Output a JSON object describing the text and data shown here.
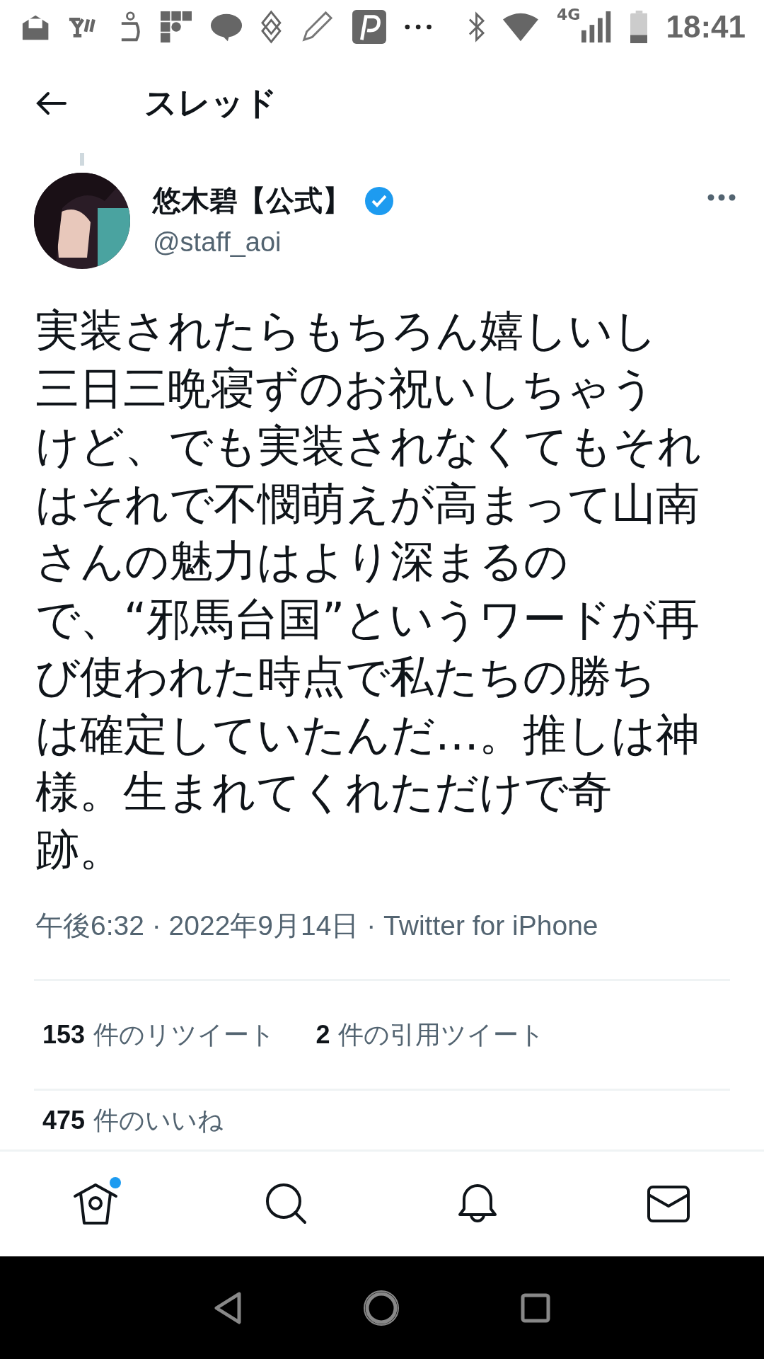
{
  "status_bar": {
    "network": "4G",
    "time": "18:41"
  },
  "header": {
    "title": "スレッド"
  },
  "tweet": {
    "author": {
      "name": "悠木碧【公式】",
      "verified": true,
      "handle": "@staff_aoi"
    },
    "text_lines": [
      "実装されたらもちろん嬉しいし",
      "三日三晩寝ずのお祝いしちゃう",
      "けど、でも実装されなくてもそれ",
      "はそれで不憫萌えが高まって山南",
      "さんの魅力はより深まるの",
      "で、“邪馬台国”というワードが再",
      "び使われた時点で私たちの勝ち",
      "は確定していたんだ…。推しは神",
      "様。生まれてくれただけで奇",
      "跡。"
    ],
    "meta": "午後6:32 · 2022年9月14日 · Twitter for iPhone",
    "stats": [
      {
        "count": "153",
        "label": "件のリツイート"
      },
      {
        "count": "2",
        "label": "件の引用ツイート"
      }
    ],
    "likes": {
      "count": "475",
      "label": "件のいいね"
    }
  },
  "tab_bar": [
    {
      "kind": "home",
      "badge": true
    },
    {
      "kind": "search",
      "badge": false
    },
    {
      "kind": "notifications",
      "badge": false
    },
    {
      "kind": "messages",
      "badge": false
    }
  ]
}
